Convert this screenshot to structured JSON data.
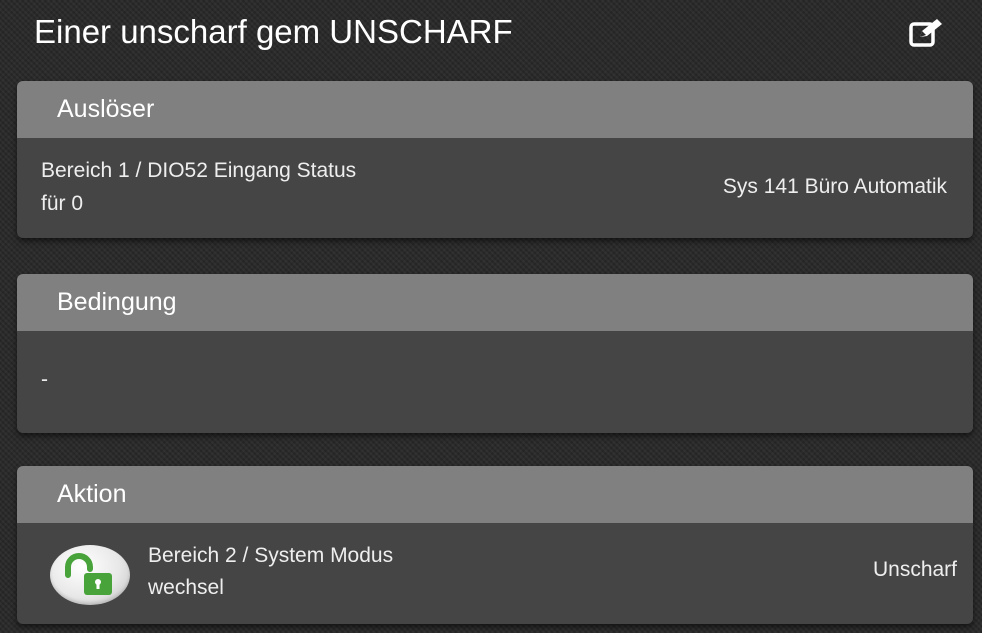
{
  "header": {
    "title": "Einer unscharf gem UNSCHARF",
    "edit_icon": "edit-icon"
  },
  "trigger": {
    "title": "Auslöser",
    "line1": "Bereich 1 / DIO52 Eingang Status",
    "line2": "für 0",
    "value": "Sys 141 Büro Automatik"
  },
  "condition": {
    "title": "Bedingung",
    "value": "-"
  },
  "action": {
    "title": "Aktion",
    "icon": "unlocked-padlock-icon",
    "line1": "Bereich 2 / System Modus",
    "line2": "wechsel",
    "value": "Unscharf"
  },
  "colors": {
    "background": "#2a2a2a",
    "card_header": "#808080",
    "card_body": "#454545",
    "lock_green": "#49a33b"
  }
}
